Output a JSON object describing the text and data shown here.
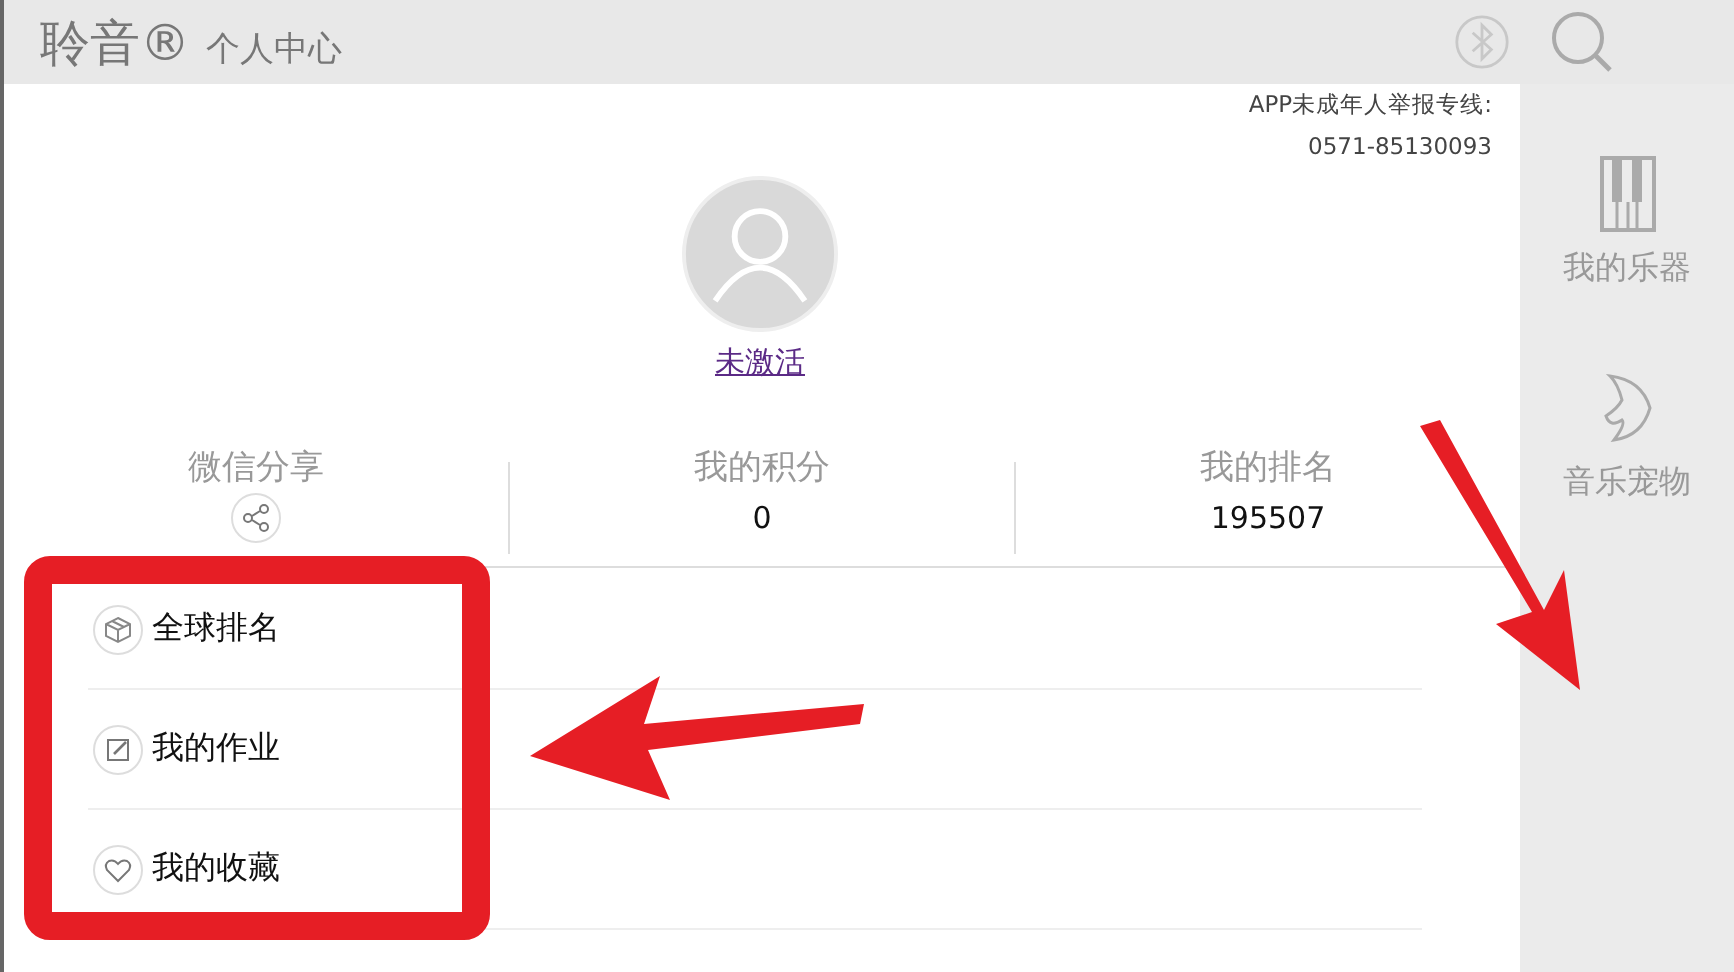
{
  "header": {
    "brand": "聆音®",
    "title": "个人中心"
  },
  "hotline": {
    "label": "APP未成年人举报专线:",
    "number": "0571-85130093"
  },
  "profile": {
    "status": "未激活"
  },
  "stats": [
    {
      "kind": "share",
      "label": "微信分享"
    },
    {
      "kind": "value",
      "label": "我的积分",
      "value": "0"
    },
    {
      "kind": "value",
      "label": "我的排名",
      "value": "195507"
    }
  ],
  "menu": [
    {
      "kind": "ranking",
      "label": "全球排名"
    },
    {
      "kind": "homework",
      "label": "我的作业"
    },
    {
      "kind": "favorites",
      "label": "我的收藏"
    }
  ],
  "sidebar": {
    "items": [
      {
        "kind": "piano",
        "label": "我的乐器"
      },
      {
        "kind": "fish",
        "label": "音乐宠物"
      }
    ]
  }
}
